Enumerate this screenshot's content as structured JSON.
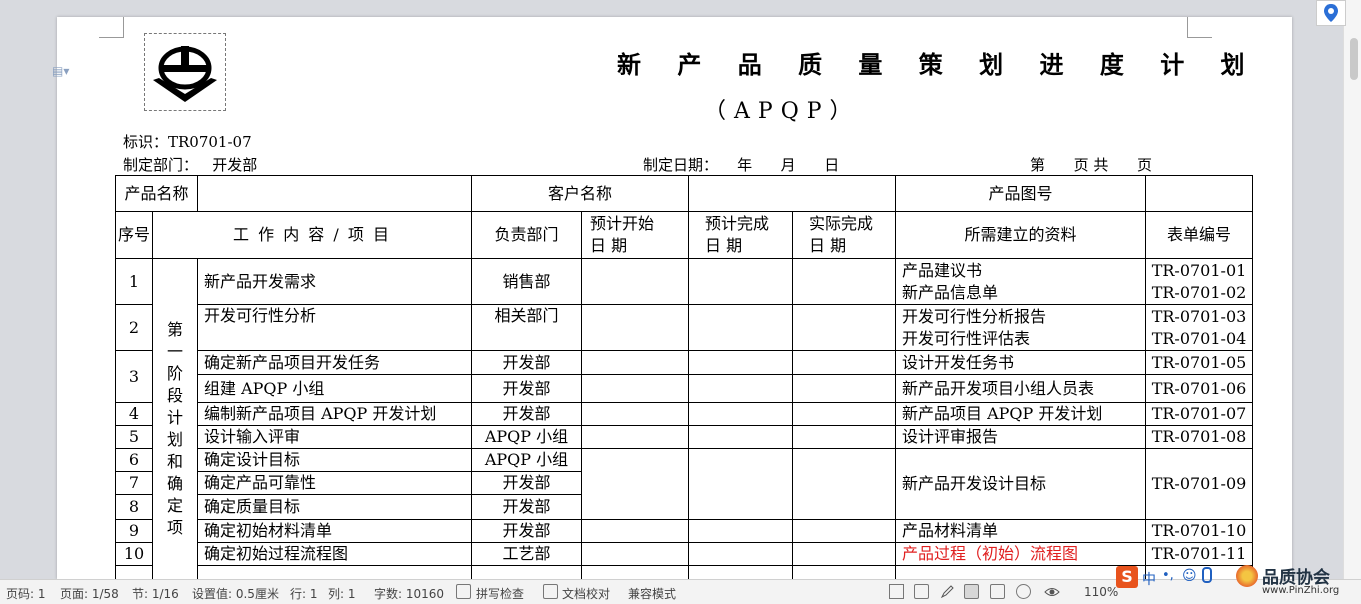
{
  "document": {
    "title": "新 产 品 质 量 策 划 进 度 计 划",
    "subtitle": "（APQP）",
    "id_line": "标识：TR0701-07",
    "dept_line": "制定部门：   开发部",
    "date_line": "制定日期：    年      月      日",
    "page_line": "第      页 共      页"
  },
  "top_row": {
    "product_name_label": "产品名称",
    "customer_name_label": "客户名称",
    "product_drawing_label": "产品图号"
  },
  "headers": {
    "no": "序号",
    "work": "工 作 内 容 / 项 目",
    "dept": "负责部门",
    "plan_start_1": "预计开始",
    "plan_start_2": "日      期",
    "plan_end_1": "预计完成",
    "plan_end_2": "日      期",
    "actual_end_1": "实际完成",
    "actual_end_2": "日      期",
    "docs": "所需建立的资料",
    "form_no": "表单编号"
  },
  "stage": "第一阶段 计划和确定项",
  "rows": {
    "r1": {
      "no": "1",
      "work": "新产品开发需求",
      "dept": "销售部",
      "doc_a": "产品建议书",
      "doc_b": "新产品信息单",
      "form_a": "TR-0701-01",
      "form_b": "TR-0701-02"
    },
    "r2": {
      "no": "2",
      "work": "开发可行性分析",
      "dept": "相关部门",
      "doc_a": "开发可行性分析报告",
      "doc_b": "开发可行性评估表",
      "form_a": "TR-0701-03",
      "form_b": "TR-0701-04"
    },
    "r3a": {
      "no": "3",
      "work": "确定新产品项目开发任务",
      "dept": "开发部",
      "doc": "设计开发任务书",
      "form": "TR-0701-05"
    },
    "r3b": {
      "work": "组建 APQP 小组",
      "dept": "开发部",
      "doc": "新产品开发项目小组人员表",
      "form": "TR-0701-06"
    },
    "r4": {
      "no": "4",
      "work": "编制新产品项目 APQP 开发计划",
      "dept": "开发部",
      "doc": "新产品项目 APQP 开发计划",
      "form": "TR-0701-07"
    },
    "r5": {
      "no": "5",
      "work": "设计输入评审",
      "dept": "APQP 小组",
      "doc": "设计评审报告",
      "form": "TR-0701-08"
    },
    "r6": {
      "no": "6",
      "work": "确定设计目标",
      "dept": "APQP 小组",
      "doc": "新产品开发设计目标",
      "form": "TR-0701-09"
    },
    "r7": {
      "no": "7",
      "work": "确定产品可靠性",
      "dept": "开发部"
    },
    "r8": {
      "no": "8",
      "work": "确定质量目标",
      "dept": "开发部"
    },
    "r9": {
      "no": "9",
      "work": "确定初始材料清单",
      "dept": "开发部",
      "doc": "产品材料清单",
      "form": "TR-0701-10"
    },
    "r10": {
      "no": "10",
      "work": "确定初始过程流程图",
      "dept": "工艺部",
      "doc": "产品过程（初始）流程图",
      "form": "TR-0701-11"
    }
  },
  "colors": {
    "red_text": "#e02020"
  },
  "status_bar": {
    "page_code": "页码: 1",
    "page": "页面: 1/58",
    "section": "节: 1/16",
    "setting": "设置值: 0.5厘米",
    "line": "行: 1",
    "col": "列: 1",
    "words": "字数: 10160",
    "spell": "拼写检查",
    "proof": "文档校对",
    "compat": "兼容模式",
    "zoom": "110%"
  },
  "watermark": {
    "name": "品质协会",
    "url": "www.PinZhi.org"
  },
  "ime": {
    "lang": "中"
  }
}
